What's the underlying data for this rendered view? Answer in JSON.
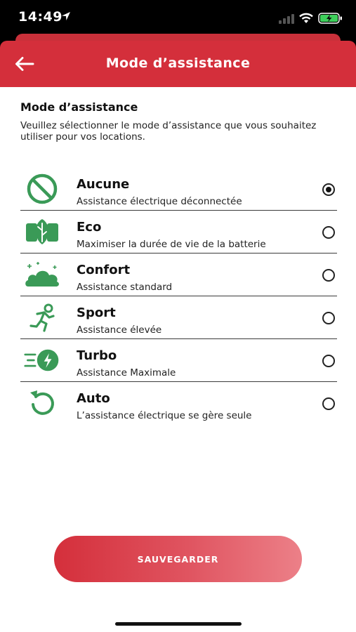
{
  "status_bar": {
    "time": "14:49"
  },
  "header": {
    "title": "Mode d’assistance",
    "back_icon": "arrow-left-icon"
  },
  "section": {
    "title": "Mode d’assistance",
    "description": "Veuillez sélectionner le mode d’assistance que vous souhaitez utiliser pour vos locations."
  },
  "options": [
    {
      "name": "Aucune",
      "description": "Assistance électrique déconnectée",
      "icon": "prohibited-icon",
      "selected": true
    },
    {
      "name": "Eco",
      "description": "Maximiser la durée de vie de la batterie",
      "icon": "eco-battery-leaf-icon",
      "selected": false
    },
    {
      "name": "Confort",
      "description": "Assistance standard",
      "icon": "cloud-icon",
      "selected": false
    },
    {
      "name": "Sport",
      "description": "Assistance élevée",
      "icon": "runner-icon",
      "selected": false
    },
    {
      "name": "Turbo",
      "description": "Assistance Maximale",
      "icon": "turbo-bolt-icon",
      "selected": false
    },
    {
      "name": "Auto",
      "description": "L’assistance électrique se gère seule",
      "icon": "auto-refresh-icon",
      "selected": false
    }
  ],
  "save_button": {
    "label": "SAUVEGARDER"
  },
  "colors": {
    "brand_red": "#d42f3b",
    "icon_green": "#3a9a57",
    "text_dark": "#111111"
  }
}
